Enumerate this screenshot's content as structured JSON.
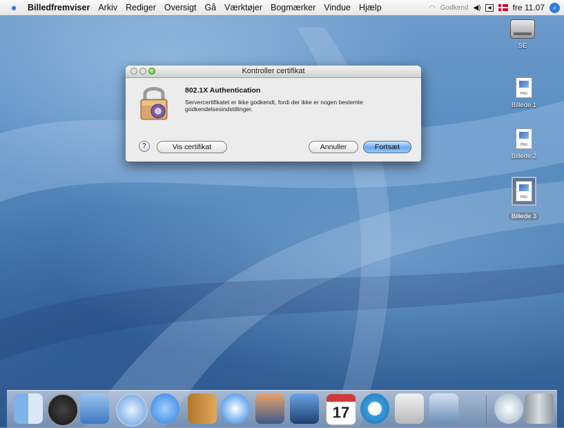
{
  "menubar": {
    "app_name": "Billedfremviser",
    "menus": [
      "Arkiv",
      "Rediger",
      "Oversigt",
      "Gå",
      "Værktøjer",
      "Bogmærker",
      "Vindue",
      "Hjælp"
    ],
    "wifi_status": "Godkend",
    "clock": "fre 11.07"
  },
  "dialog": {
    "title": "Kontroller certifikat",
    "heading": "802.1X Authentication",
    "message": "Servercertifikatet er ikke godkendt, fordi der ikke er nogen bestemte godkendelsesindstillinger.",
    "help_label": "?",
    "show_certificate_label": "Vis certifikat",
    "cancel_label": "Annuller",
    "continue_label": "Fortsæt"
  },
  "desktop_icons": [
    {
      "label": "SE",
      "icon": "hard-drive-icon"
    },
    {
      "label": "Billede 1",
      "icon": "png-file-icon",
      "badge": "PNG"
    },
    {
      "label": "Billede 2",
      "icon": "png-file-icon",
      "badge": "PNG"
    },
    {
      "label": "Billede 3",
      "icon": "png-file-icon",
      "badge": "PNG",
      "selected": true
    }
  ],
  "dock": {
    "items": [
      "finder-icon",
      "dashboard-icon",
      "mail-icon",
      "safari-icon",
      "ichat-icon",
      "address-book-icon",
      "itunes-icon",
      "iphoto-icon",
      "imovie-icon",
      "ical-icon",
      "quicktime-icon",
      "system-preferences-icon",
      "preview-icon",
      "mail-drop-icon",
      "trash-icon"
    ],
    "ical_date": "17"
  },
  "colors": {
    "default_button": "#6aaaf0",
    "desktop": "#5a8ec2",
    "menubar": "#eeeeee"
  }
}
